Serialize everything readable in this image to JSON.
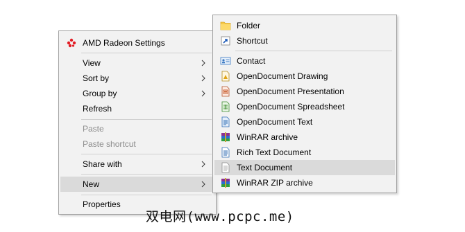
{
  "context_menu": {
    "items": [
      {
        "label": "AMD Radeon Settings",
        "icon": "amd-radeon-icon"
      },
      {
        "label": "View",
        "has_submenu": true
      },
      {
        "label": "Sort by",
        "has_submenu": true
      },
      {
        "label": "Group by",
        "has_submenu": true
      },
      {
        "label": "Refresh"
      },
      {
        "label": "Paste",
        "disabled": true
      },
      {
        "label": "Paste shortcut",
        "disabled": true
      },
      {
        "label": "Share with",
        "has_submenu": true
      },
      {
        "label": "New",
        "has_submenu": true,
        "highlighted": true
      },
      {
        "label": "Properties"
      }
    ]
  },
  "new_submenu": {
    "items": [
      {
        "label": "Folder",
        "icon": "folder-icon"
      },
      {
        "label": "Shortcut",
        "icon": "shortcut-icon"
      },
      {
        "label": "Contact",
        "icon": "contact-icon"
      },
      {
        "label": "OpenDocument Drawing",
        "icon": "odf-drawing-icon"
      },
      {
        "label": "OpenDocument Presentation",
        "icon": "odf-presentation-icon"
      },
      {
        "label": "OpenDocument Spreadsheet",
        "icon": "odf-spreadsheet-icon"
      },
      {
        "label": "OpenDocument Text",
        "icon": "odf-text-icon"
      },
      {
        "label": "WinRAR archive",
        "icon": "winrar-icon"
      },
      {
        "label": "Rich Text Document",
        "icon": "rtf-document-icon"
      },
      {
        "label": "Text Document",
        "icon": "text-document-icon",
        "highlighted": true
      },
      {
        "label": "WinRAR ZIP archive",
        "icon": "winrar-zip-icon"
      }
    ]
  },
  "watermark": "双电网(www.pcpc.me)",
  "colors": {
    "menu_bg": "#f2f2f2",
    "highlight": "#dadada",
    "disabled_text": "#8e8e8e",
    "amd_red": "#e21b23"
  }
}
